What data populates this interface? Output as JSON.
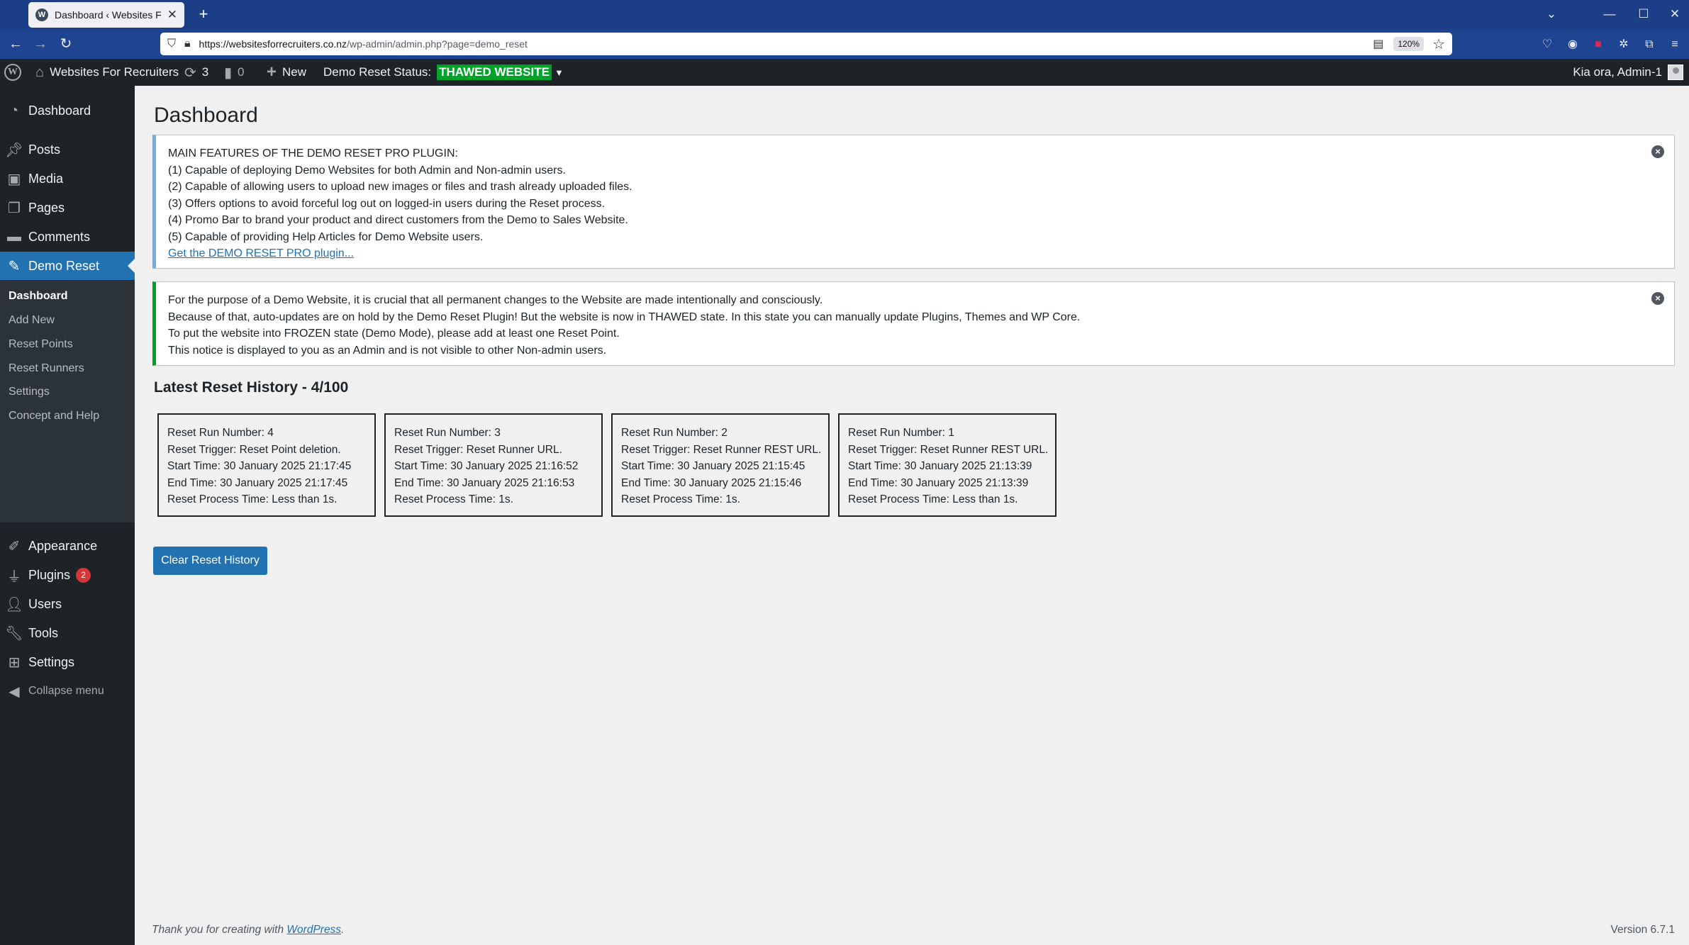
{
  "browser": {
    "tab_title": "Dashboard ‹ Websites For Recruiters",
    "tab_favicon": "W",
    "url_host": "https://websitesforrecruiters.co.nz",
    "url_path": "/wp-admin/admin.php?page=demo_reset",
    "zoom": "120%"
  },
  "adminbar": {
    "site_name": "Websites For Recruiters",
    "updates_count": "3",
    "comments_count": "0",
    "new_label": "New",
    "demo_status_label": "Demo Reset Status:",
    "demo_status_value": "THAWED WEBSITE",
    "demo_status_arrow": "▼",
    "greeting": "Kia ora, Admin-1",
    "status_color": "#00a32a"
  },
  "sidebar": {
    "items": [
      {
        "label": "Dashboard",
        "icon": "dashboard-icon"
      },
      {
        "label": "Posts",
        "icon": "pin-icon"
      },
      {
        "label": "Media",
        "icon": "media-icon"
      },
      {
        "label": "Pages",
        "icon": "pages-icon"
      },
      {
        "label": "Comments",
        "icon": "comment-icon"
      },
      {
        "label": "Demo Reset",
        "icon": "brush-icon"
      },
      {
        "label": "Appearance",
        "icon": "paintbrush-icon"
      },
      {
        "label": "Plugins",
        "icon": "plugin-icon"
      },
      {
        "label": "Users",
        "icon": "users-icon"
      },
      {
        "label": "Tools",
        "icon": "wrench-icon"
      },
      {
        "label": "Settings",
        "icon": "settings-icon"
      }
    ],
    "plugins_badge": "2",
    "submenu": [
      "Dashboard",
      "Add New",
      "Reset Points",
      "Reset Runners",
      "Settings",
      "Concept and Help"
    ],
    "collapse_label": "Collapse menu",
    "active_color": "#2271b1"
  },
  "main": {
    "title": "Dashboard",
    "features_notice": {
      "heading": "MAIN FEATURES OF THE DEMO RESET PRO PLUGIN:",
      "lines": [
        "(1) Capable of deploying Demo Websites for both Admin and Non-admin users.",
        "(2) Capable of allowing users to upload new images or files and trash already uploaded files.",
        "(3) Offers options to avoid forceful log out on logged-in users during the Reset process.",
        "(4) Promo Bar to brand your product and direct customers from the Demo to Sales Website.",
        "(5) Capable of providing Help Articles for Demo Website users."
      ],
      "link": "Get the DEMO RESET PRO plugin..."
    },
    "thawed_notice": {
      "lines": [
        "For the purpose of a Demo Website, it is crucial that all permanent changes to the Website are made intentionally and consciously.",
        "Because of that, auto-updates are on hold by the Demo Reset Plugin! But the website is now in THAWED state. In this state you can manually update Plugins, Themes and WP Core.",
        "To put the website into FROZEN state (Demo Mode), please add at least one Reset Point.",
        "This notice is displayed to you as an Admin and is not visible to other Non-admin users."
      ]
    },
    "history_title": "Latest Reset History - 4/100",
    "history": [
      [
        "Reset Run Number: 4",
        "Reset Trigger: Reset Point deletion.",
        "Start Time: 30 January 2025 21:17:45",
        "End Time: 30 January 2025 21:17:45",
        "Reset Process Time: Less than 1s."
      ],
      [
        "Reset Run Number: 3",
        "Reset Trigger: Reset Runner URL.",
        "Start Time: 30 January 2025 21:16:52",
        "End Time: 30 January 2025 21:16:53",
        "Reset Process Time: 1s."
      ],
      [
        "Reset Run Number: 2",
        "Reset Trigger: Reset Runner REST URL.",
        "Start Time: 30 January 2025 21:15:45",
        "End Time: 30 January 2025 21:15:46",
        "Reset Process Time: 1s."
      ],
      [
        "Reset Run Number: 1",
        "Reset Trigger: Reset Runner REST URL.",
        "Start Time: 30 January 2025 21:13:39",
        "End Time: 30 January 2025 21:13:39",
        "Reset Process Time: Less than 1s."
      ]
    ],
    "clear_button": "Clear Reset History"
  },
  "footer": {
    "thanks_prefix": "Thank you for creating with",
    "thanks_link": "WordPress",
    "thanks_suffix": ".",
    "version": "Version 6.7.1"
  }
}
